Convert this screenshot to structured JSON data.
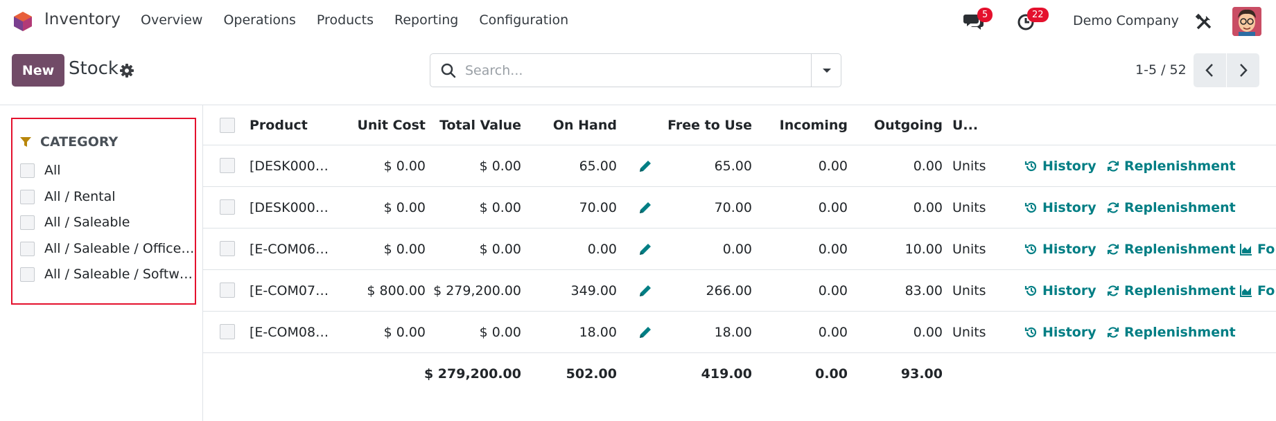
{
  "app": {
    "name": "Inventory"
  },
  "menu": [
    "Overview",
    "Operations",
    "Products",
    "Reporting",
    "Configuration"
  ],
  "systray": {
    "messages_count": "5",
    "activities_count": "22",
    "company": "Demo Company"
  },
  "control": {
    "new_label": "New",
    "title": "Stock",
    "search_placeholder": "Search...",
    "pager": "1-5 / 52"
  },
  "sidebar": {
    "heading": "CATEGORY",
    "items": [
      "All",
      "All / Rental",
      "All / Saleable",
      "All / Saleable / Office Furniture",
      "All / Saleable / Software"
    ]
  },
  "table": {
    "headers": [
      "Product",
      "Unit Cost",
      "Total Value",
      "On Hand",
      "Free to Use",
      "Incoming",
      "Outgoing",
      "U..."
    ],
    "rows": [
      {
        "product": "[DESK000…",
        "unit_cost": "$ 0.00",
        "total_value": "$ 0.00",
        "on_hand": "65.00",
        "free": "65.00",
        "incoming": "0.00",
        "outgoing": "0.00",
        "uom": "Units",
        "forecast": false
      },
      {
        "product": "[DESK000…",
        "unit_cost": "$ 0.00",
        "total_value": "$ 0.00",
        "on_hand": "70.00",
        "free": "70.00",
        "incoming": "0.00",
        "outgoing": "0.00",
        "uom": "Units",
        "forecast": false
      },
      {
        "product": "[E-COM06…",
        "unit_cost": "$ 0.00",
        "total_value": "$ 0.00",
        "on_hand": "0.00",
        "free": "0.00",
        "incoming": "0.00",
        "outgoing": "10.00",
        "uom": "Units",
        "forecast": true
      },
      {
        "product": "[E-COM07…",
        "unit_cost": "$ 800.00",
        "total_value": "$ 279,200.00",
        "on_hand": "349.00",
        "free": "266.00",
        "incoming": "0.00",
        "outgoing": "83.00",
        "uom": "Units",
        "forecast": true
      },
      {
        "product": "[E-COM08…",
        "unit_cost": "$ 0.00",
        "total_value": "$ 0.00",
        "on_hand": "18.00",
        "free": "18.00",
        "incoming": "0.00",
        "outgoing": "0.00",
        "uom": "Units",
        "forecast": false
      }
    ],
    "totals": {
      "total_value": "$ 279,200.00",
      "on_hand": "502.00",
      "free": "419.00",
      "incoming": "0.00",
      "outgoing": "93.00"
    },
    "actions": {
      "history": "History",
      "replenishment": "Replenishment",
      "forecast": "Fo"
    }
  },
  "icons": [
    "odoo-logo-icon",
    "chat-icon",
    "clock-icon",
    "tools-icon",
    "gear-icon",
    "search-icon",
    "caret-down-icon",
    "chevron-left-icon",
    "chevron-right-icon",
    "filter-icon",
    "pencil-icon",
    "history-icon",
    "refresh-icon",
    "chart-icon"
  ],
  "colors": {
    "brand": "#714b67",
    "link": "#017e84",
    "badge": "#e4112d",
    "highlight": "#e4112d"
  }
}
